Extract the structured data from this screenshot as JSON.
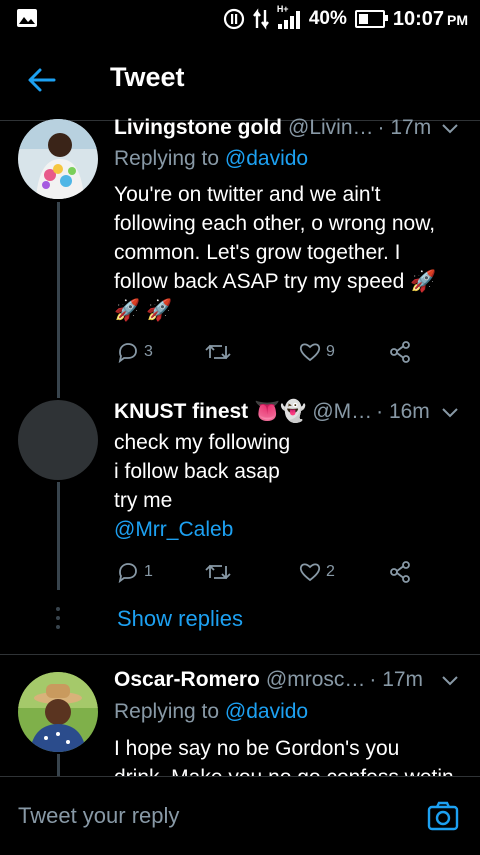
{
  "status_bar": {
    "battery": "40%",
    "battery_level": 0.4,
    "time": "10:07",
    "ampm": "PM",
    "network": "H+"
  },
  "header": {
    "title": "Tweet"
  },
  "tweets": [
    {
      "name": "Livingstone gold",
      "handle": "@Livin…",
      "time": "· 17m",
      "replying_prefix": "Replying to",
      "replying_to": "@davido",
      "body": "You're on twitter and we ain't following each other, o wrong now, common. Let's grow together. I follow back ASAP try my speed 🚀 🚀 🚀",
      "replies": "3",
      "likes": "9"
    },
    {
      "name": "KNUST finest 👅👻",
      "handle": "@M…",
      "time": "· 16m",
      "body_lines": [
        "check my following",
        "i follow back asap",
        "try me"
      ],
      "mention": "@Mrr_Caleb",
      "replies": "1",
      "likes": "2",
      "show_replies": "Show replies"
    },
    {
      "name": "Oscar-Romero",
      "handle": "@mrosc…",
      "time": "· 17m",
      "replying_prefix": "Replying to",
      "replying_to": "@davido",
      "body": "I hope say no be Gordon's you drink. Make you no go confess wetin"
    }
  ],
  "reply_bar": {
    "placeholder": "Tweet your reply"
  },
  "colors": {
    "accent": "#1da1f2",
    "muted": "#8899a6",
    "background": "#000000"
  }
}
